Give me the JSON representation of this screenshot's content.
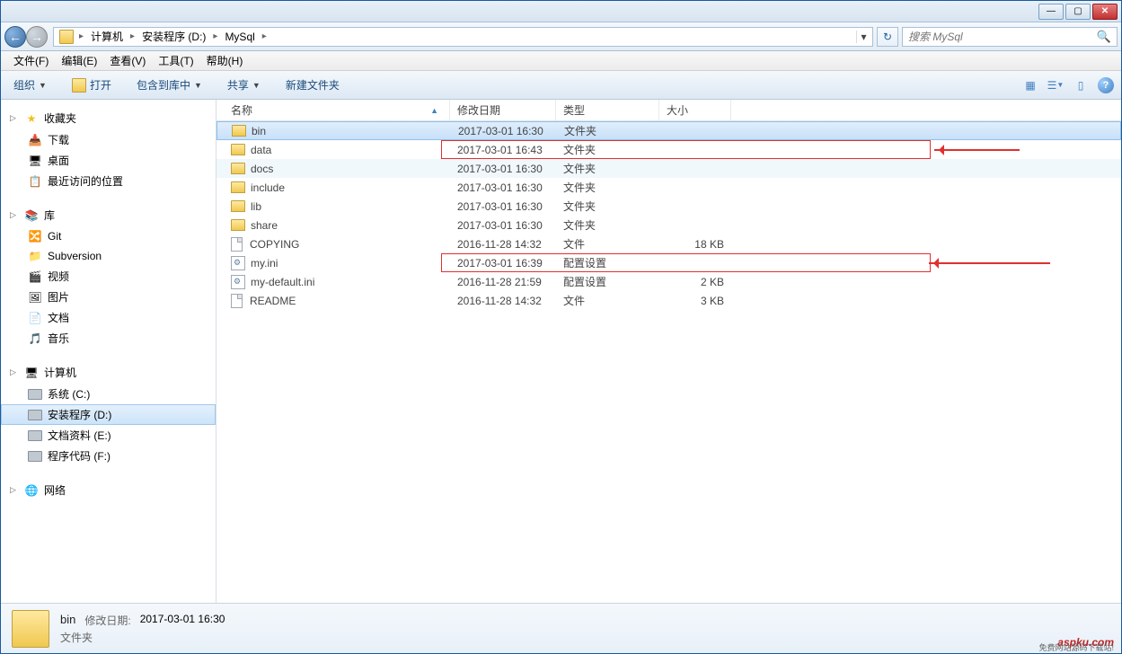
{
  "window": {
    "minimize": "—",
    "maximize": "▢",
    "close": "✕"
  },
  "nav": {
    "back_symbol": "←",
    "forward_symbol": "→",
    "drop_symbol": "▾",
    "refresh_symbol": "↻"
  },
  "breadcrumb": {
    "items": [
      "计算机",
      "安装程序 (D:)",
      "MySql"
    ],
    "sep": "▸"
  },
  "search": {
    "placeholder": "搜索 MySql",
    "icon": "🔍"
  },
  "menubar": [
    {
      "label": "文件(F)"
    },
    {
      "label": "编辑(E)"
    },
    {
      "label": "查看(V)"
    },
    {
      "label": "工具(T)"
    },
    {
      "label": "帮助(H)"
    }
  ],
  "toolbar": {
    "organize": "组织",
    "open": "打开",
    "include": "包含到库中",
    "share": "共享",
    "newfolder": "新建文件夹",
    "drop": "▼"
  },
  "toolbar_right": {
    "help": "?"
  },
  "sidebar": {
    "favorites": {
      "title": "收藏夹",
      "items": [
        {
          "icon": "📥",
          "label": "下载"
        },
        {
          "icon": "🖥",
          "label": "桌面"
        },
        {
          "icon": "📋",
          "label": "最近访问的位置"
        }
      ]
    },
    "libraries": {
      "title": "库",
      "items": [
        {
          "icon": "🔀",
          "label": "Git"
        },
        {
          "icon": "📁",
          "label": "Subversion"
        },
        {
          "icon": "🎬",
          "label": "视频"
        },
        {
          "icon": "🖼",
          "label": "图片"
        },
        {
          "icon": "📄",
          "label": "文档"
        },
        {
          "icon": "🎵",
          "label": "音乐"
        }
      ]
    },
    "computer": {
      "title": "计算机",
      "items": [
        {
          "label": "系统 (C:)"
        },
        {
          "label": "安装程序 (D:)",
          "selected": true
        },
        {
          "label": "文档资料 (E:)"
        },
        {
          "label": "程序代码 (F:)"
        }
      ]
    },
    "network": {
      "title": "网络",
      "icon": "🌐"
    }
  },
  "columns": {
    "name": "名称",
    "date": "修改日期",
    "type": "类型",
    "size": "大小",
    "sort": "▲"
  },
  "files": [
    {
      "icon": "folder",
      "name": "bin",
      "date": "2017-03-01 16:30",
      "type": "文件夹",
      "size": "",
      "selected": true
    },
    {
      "icon": "folder",
      "name": "data",
      "date": "2017-03-01 16:43",
      "type": "文件夹",
      "size": "",
      "highlight": true
    },
    {
      "icon": "folder",
      "name": "docs",
      "date": "2017-03-01 16:30",
      "type": "文件夹",
      "size": "",
      "alt_hover": true
    },
    {
      "icon": "folder",
      "name": "include",
      "date": "2017-03-01 16:30",
      "type": "文件夹",
      "size": ""
    },
    {
      "icon": "folder",
      "name": "lib",
      "date": "2017-03-01 16:30",
      "type": "文件夹",
      "size": ""
    },
    {
      "icon": "folder",
      "name": "share",
      "date": "2017-03-01 16:30",
      "type": "文件夹",
      "size": ""
    },
    {
      "icon": "file",
      "name": "COPYING",
      "date": "2016-11-28 14:32",
      "type": "文件",
      "size": "18 KB"
    },
    {
      "icon": "ini",
      "name": "my.ini",
      "date": "2017-03-01 16:39",
      "type": "配置设置",
      "size": "",
      "highlight": true
    },
    {
      "icon": "ini",
      "name": "my-default.ini",
      "date": "2016-11-28 21:59",
      "type": "配置设置",
      "size": "2 KB"
    },
    {
      "icon": "file",
      "name": "README",
      "date": "2016-11-28 14:32",
      "type": "文件",
      "size": "3 KB"
    }
  ],
  "statusbar": {
    "name": "bin",
    "date_label": "修改日期:",
    "date_value": "2017-03-01 16:30",
    "type": "文件夹"
  },
  "watermark": {
    "main": "aspku.com",
    "sub": "免费网站源码下载站!"
  }
}
